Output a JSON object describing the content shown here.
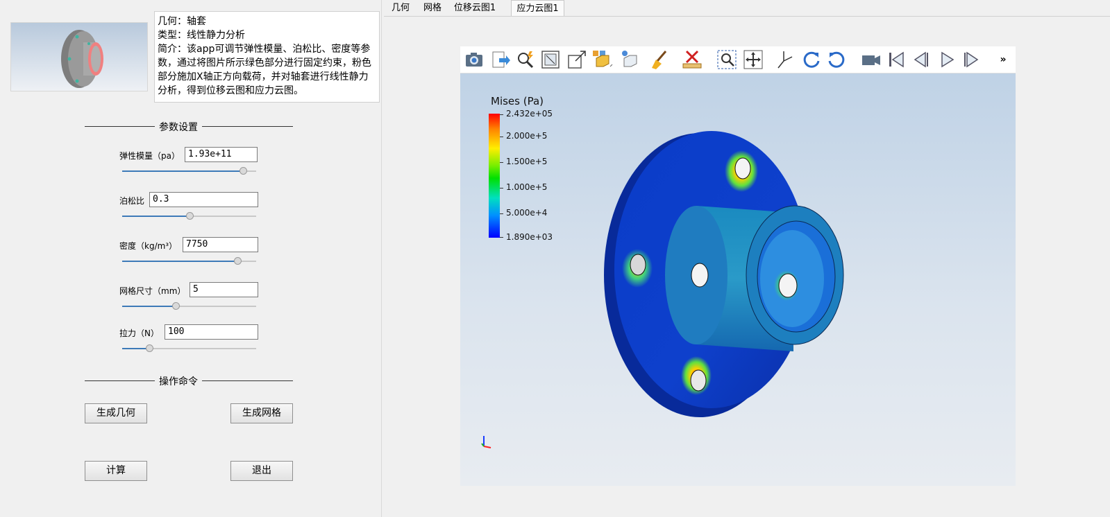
{
  "tabs": [
    {
      "label": "几何"
    },
    {
      "label": "网格"
    },
    {
      "label": "位移云图1"
    },
    {
      "label": "应力云图1"
    }
  ],
  "active_tab": "应力云图1",
  "description": {
    "geometry": "几何：轴套",
    "type": "类型：线性静力分析",
    "intro": "简介：该app可调节弹性模量、泊松比、密度等参数，通过将图片所示绿色部分进行固定约束，粉色部分施加X轴正方向载荷，并对轴套进行线性静力分析，得到位移云图和应力云图。"
  },
  "sections": {
    "params": "参数设置",
    "commands": "操作命令"
  },
  "params": [
    {
      "label": "弹性模量（pa）",
      "value": "1.93e+11",
      "slider": 0.9
    },
    {
      "label": "泊松比",
      "value": "0.3",
      "slider": 0.5
    },
    {
      "label": "密度（kg/m³）",
      "value": "7750",
      "slider": 0.86
    },
    {
      "label": "网格尺寸（mm）",
      "value": "5",
      "slider": 0.4
    },
    {
      "label": "拉力（N）",
      "value": "100",
      "slider": 0.2
    }
  ],
  "buttons": {
    "gen_geometry": "生成几何",
    "gen_mesh": "生成网格",
    "compute": "计算",
    "exit": "退出"
  },
  "legend": {
    "title": "Mises (Pa)",
    "ticks": [
      "2.432e+05",
      "2.000e+5",
      "1.500e+5",
      "1.000e+5",
      "5.000e+4",
      "1.890e+03"
    ]
  },
  "toolbar_icons": [
    "camera-icon",
    "export-icon",
    "probe-icon",
    "fit-box-icon",
    "resize-icon",
    "box-select-icon",
    "cube-view-icon",
    "clear-brush-icon",
    "ruler-delete-icon",
    "zoom-box-icon",
    "pan-icon",
    "axes-icon",
    "rotate-cw-icon",
    "rotate-ccw-icon",
    "video-icon",
    "first-frame-icon",
    "prev-frame-icon",
    "play-icon",
    "next-frame-icon",
    "more-icon"
  ],
  "colors": {
    "accent": "#3d7ab8"
  }
}
